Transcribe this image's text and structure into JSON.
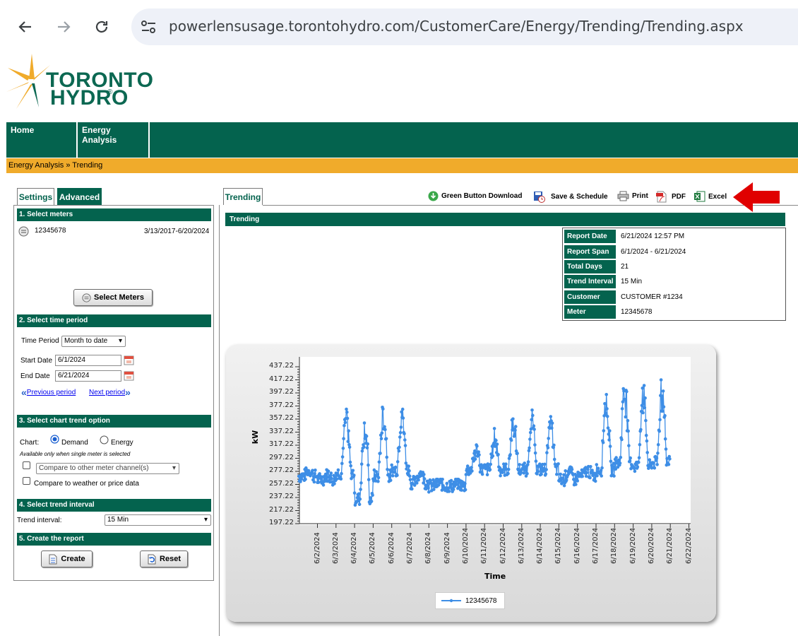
{
  "browser": {
    "url": "powerlensusage.torontohydro.com/CustomerCare/Energy/Trending/Trending.aspx"
  },
  "logo": {
    "line1": "TORONTO",
    "line2": "HYDRO"
  },
  "topnav": [
    {
      "label": "Home"
    },
    {
      "label": "Energy Analysis"
    }
  ],
  "breadcrumb": "Energy Analysis » Trending",
  "left": {
    "tabs": [
      "Settings",
      "Advanced"
    ],
    "section1": "1. Select meters",
    "meter_id": "12345678",
    "meter_range": "3/13/2017-6/20/2024",
    "select_meters_label": "Select Meters",
    "section2": "2. Select time period",
    "time_period_label": "Time Period",
    "time_period_value": "Month to date",
    "start_label": "Start Date",
    "start_value": "6/1/2024",
    "end_label": "End Date",
    "end_value": "6/21/2024",
    "prev_label": "Previous period",
    "next_label": "Next period",
    "section3": "3. Select chart trend option",
    "chart_label": "Chart:",
    "demand_label": "Demand",
    "energy_label": "Energy",
    "note": "Available only when single meter is selected",
    "compare_channels": "Compare to other meter channel(s)",
    "compare_weather": "Compare to weather or price data",
    "section4": "4. Select trend interval",
    "trend_interval_label": "Trend interval:",
    "trend_interval_value": "15 Min",
    "section5": "5. Create the report",
    "create_label": "Create",
    "reset_label": "Reset"
  },
  "right": {
    "tab": "Trending",
    "toolbar": {
      "green_button": "Green Button Download",
      "save_schedule": "Save & Schedule",
      "print": "Print",
      "pdf": "PDF",
      "excel": "Excel"
    },
    "header": "Trending",
    "info": [
      {
        "label": "Report Date",
        "value": "6/21/2024 12:57 PM"
      },
      {
        "label": "Report Span",
        "value": "6/1/2024 - 6/21/2024"
      },
      {
        "label": "Total Days",
        "value": "21"
      },
      {
        "label": "Trend Interval",
        "value": "15 Min"
      },
      {
        "label": "Customer",
        "value": "CUSTOMER #1234"
      },
      {
        "label": "Meter",
        "value": "12345678"
      }
    ]
  },
  "colors": {
    "brand_green": "#04634e",
    "breadcrumb_bar": "#f0ab2b",
    "series": "#3e8ee6",
    "arrow": "#e00000"
  },
  "chart_data": {
    "type": "line",
    "title": "",
    "xlabel": "Time",
    "ylabel": "kW",
    "y_ticks": [
      "437.22",
      "417.22",
      "397.22",
      "377.22",
      "357.22",
      "337.22",
      "317.22",
      "297.22",
      "277.22",
      "257.22",
      "237.22",
      "217.22",
      "197.22"
    ],
    "ylim": [
      197.22,
      447.22
    ],
    "x_ticks": [
      "6/2/2024",
      "6/3/2024",
      "6/4/2024",
      "6/5/2024",
      "6/6/2024",
      "6/7/2024",
      "6/8/2024",
      "6/9/2024",
      "6/10/2024",
      "6/11/2024",
      "6/12/2024",
      "6/13/2024",
      "6/14/2024",
      "6/15/2024",
      "6/16/2024",
      "6/17/2024",
      "6/18/2024",
      "6/19/2024",
      "6/20/2024",
      "6/21/2024",
      "6/22/2024"
    ],
    "xlim": [
      "6/1/2024",
      "6/22/2024"
    ],
    "series": [
      {
        "name": "12345678",
        "x": [
          "6/1/2024",
          "6/2/2024",
          "6/3/2024",
          "6/4/2024",
          "6/5/2024",
          "6/6/2024",
          "6/7/2024",
          "6/8/2024",
          "6/9/2024",
          "6/10/2024",
          "6/11/2024",
          "6/12/2024",
          "6/13/2024",
          "6/14/2024",
          "6/15/2024",
          "6/16/2024",
          "6/17/2024",
          "6/18/2024",
          "6/19/2024",
          "6/20/2024"
        ],
        "high": [
          285,
          280,
          375,
          380,
          390,
          385,
          285,
          265,
          265,
          320,
          345,
          370,
          375,
          370,
          285,
          285,
          415,
          430,
          425,
          425
        ],
        "low": [
          245,
          240,
          250,
          210,
          245,
          255,
          235,
          230,
          230,
          255,
          255,
          255,
          255,
          255,
          240,
          245,
          255,
          265,
          260,
          265
        ]
      }
    ],
    "legend": "bottom-center",
    "grid": false
  }
}
